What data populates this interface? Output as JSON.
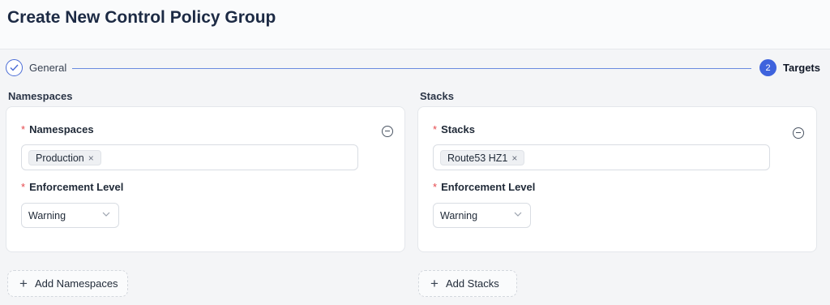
{
  "page": {
    "title": "Create New Control Policy Group"
  },
  "steps": [
    {
      "label": "General",
      "state": "done",
      "icon": "check-icon"
    },
    {
      "label": "Targets",
      "number": "2",
      "state": "active"
    }
  ],
  "namespaces": {
    "section_title": "Namespaces",
    "field_label": "Namespaces",
    "required_mark": "*",
    "tags": [
      "Production"
    ],
    "enforcement_label": "Enforcement Level",
    "enforcement_value": "Warning",
    "add_label": "Add Namespaces"
  },
  "stacks": {
    "section_title": "Stacks",
    "field_label": "Stacks",
    "required_mark": "*",
    "tags": [
      "Route53 HZ1"
    ],
    "enforcement_label": "Enforcement Level",
    "enforcement_value": "Warning",
    "add_label": "Add Stacks"
  },
  "icons": {
    "tag_remove": "×",
    "add": "+"
  },
  "colors": {
    "accent": "#3e63dd",
    "required": "#e5484d",
    "title": "#1c2a44"
  }
}
